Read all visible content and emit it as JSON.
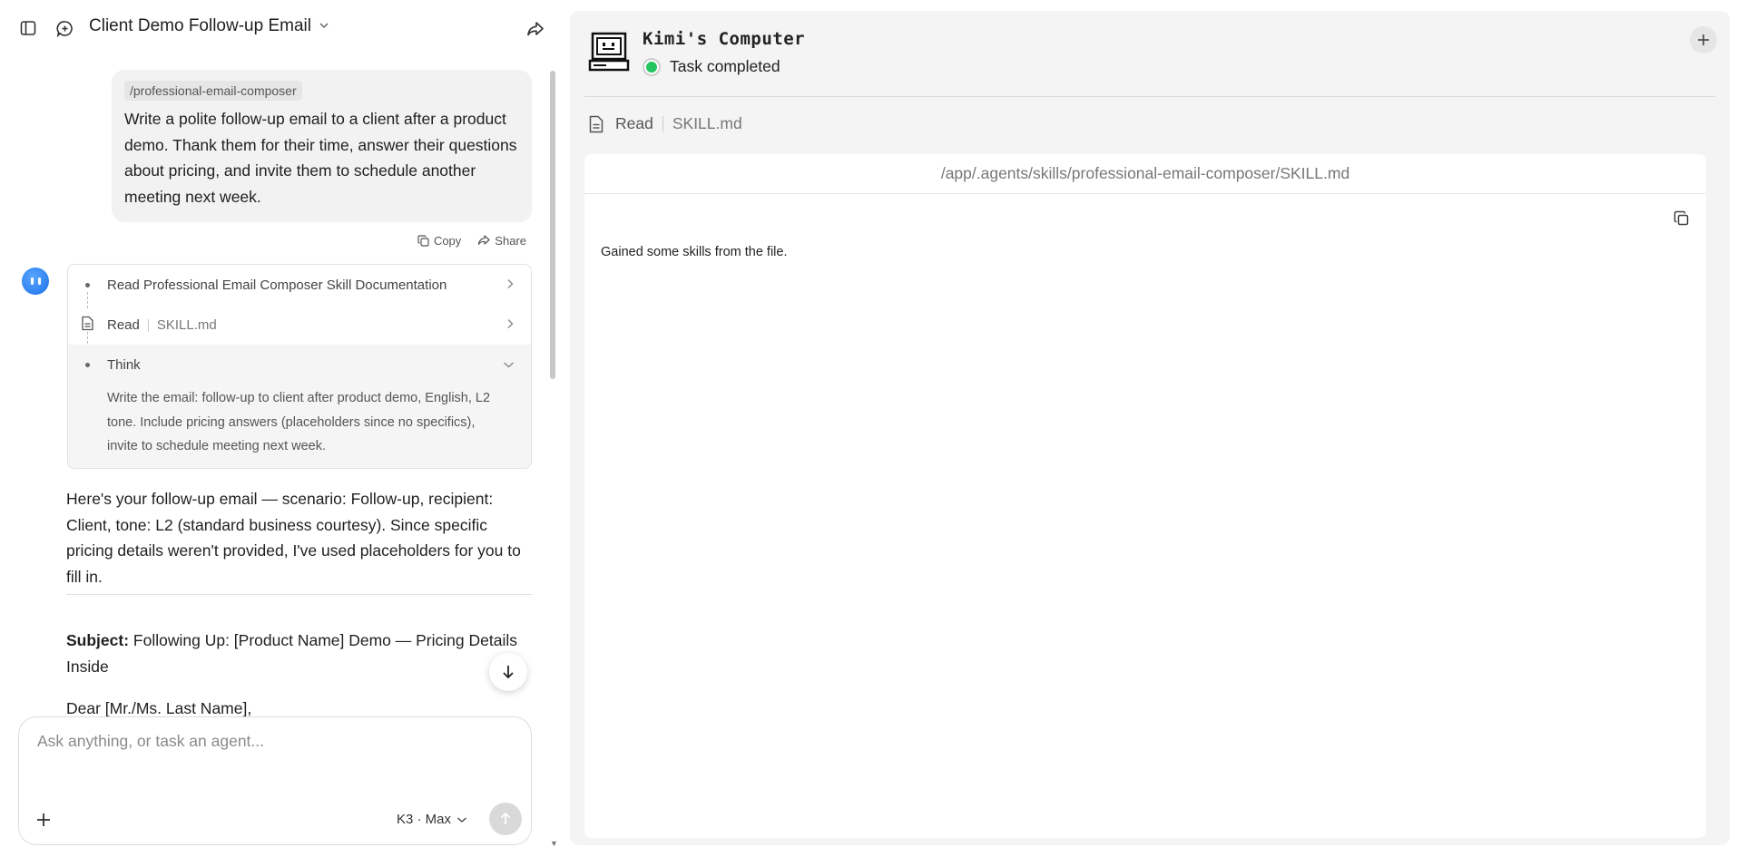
{
  "header": {
    "title": "Client Demo Follow-up Email"
  },
  "user_message": {
    "command": "/professional-email-composer",
    "text": "Write a polite follow-up email to a client after a product demo. Thank them for their time, answer their questions about pricing, and invite them to schedule another meeting next week.",
    "actions": {
      "copy": "Copy",
      "share": "Share"
    }
  },
  "steps": {
    "step1": "Read Professional Email Composer Skill Documentation",
    "step2_action": "Read",
    "step2_file": "SKILL.md",
    "step3": "Think",
    "think_text": "Write the email: follow-up to client after product demo, English, L2 tone. Include pricing answers (placeholders since no specifics), invite to schedule meeting next week."
  },
  "reply": {
    "intro": "Here's your follow-up email — scenario: Follow-up, recipient: Client, tone: L2 (standard business courtesy). Since specific pricing details weren't provided, I've used placeholders for you to fill in.",
    "subject_label": "Subject:",
    "subject": " Following Up: [Product Name] Demo — Pricing Details Inside",
    "greeting": "Dear [Mr./Ms. Last Name],"
  },
  "composer": {
    "placeholder": "Ask anything, or task an agent...",
    "model": "K3 · Max"
  },
  "computer": {
    "title": "Kimi's Computer",
    "status": "Task completed",
    "status_color": "#22c55e",
    "tool_action": "Read",
    "tool_file": "SKILL.md",
    "file_path": "/app/.agents/skills/professional-email-composer/SKILL.md",
    "content": "Gained some skills from the file."
  }
}
